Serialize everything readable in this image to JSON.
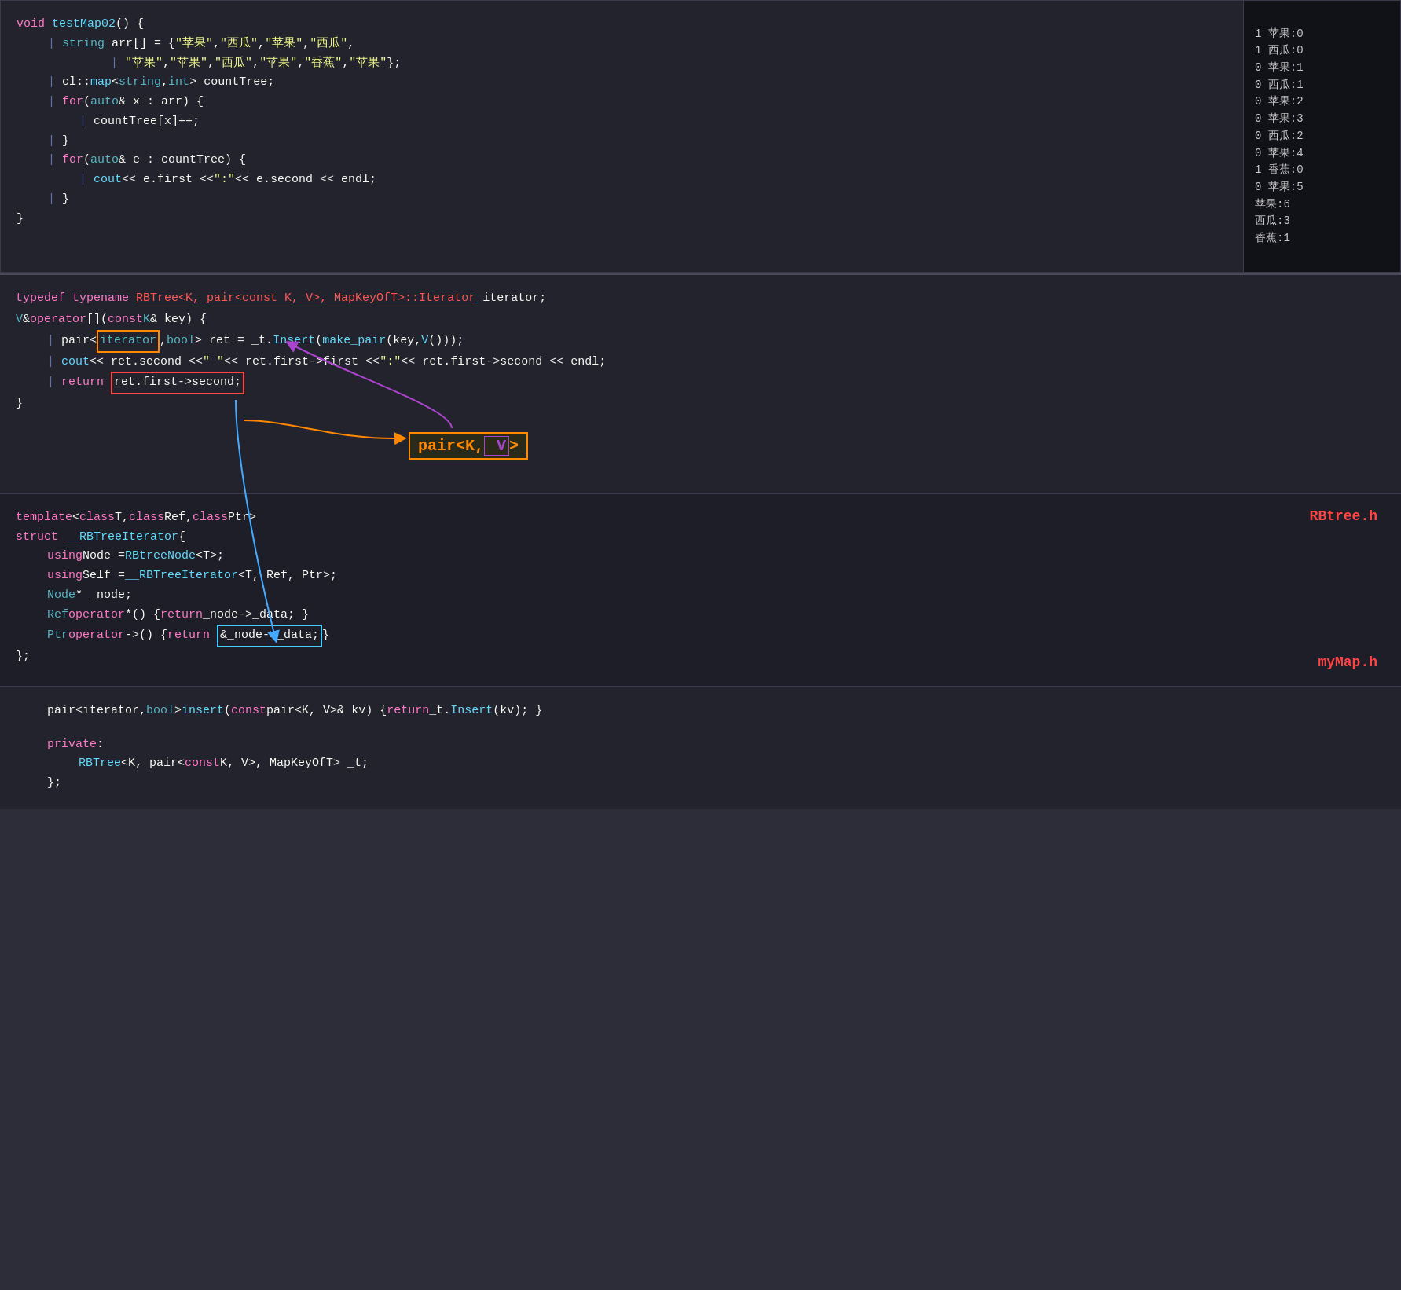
{
  "panels": {
    "top": {
      "code_lines": [
        {
          "parts": [
            {
              "t": "void",
              "c": "kw"
            },
            {
              "t": " testMap02() {",
              "c": "wht"
            }
          ]
        },
        {
          "indent": 1,
          "parts": [
            {
              "t": "string",
              "c": "cyan"
            },
            {
              "t": " arr[] = { ",
              "c": "wht"
            },
            {
              "t": "\"苹果\"",
              "c": "yel"
            },
            {
              "t": ", ",
              "c": "wht"
            },
            {
              "t": "\"西瓜\"",
              "c": "yel"
            },
            {
              "t": ", ",
              "c": "wht"
            },
            {
              "t": "\"苹果\"",
              "c": "yel"
            },
            {
              "t": ", ",
              "c": "wht"
            },
            {
              "t": "\"西瓜\"",
              "c": "yel"
            },
            {
              "t": ",",
              "c": "wht"
            }
          ]
        },
        {
          "indent": 2,
          "parts": [
            {
              "t": "\"苹果\"",
              "c": "yel"
            },
            {
              "t": ", ",
              "c": "wht"
            },
            {
              "t": "\"苹果\"",
              "c": "yel"
            },
            {
              "t": ", ",
              "c": "wht"
            },
            {
              "t": "\"西瓜\"",
              "c": "yel"
            },
            {
              "t": ", ",
              "c": "wht"
            },
            {
              "t": "\"苹果\"",
              "c": "yel"
            },
            {
              "t": ", ",
              "c": "wht"
            },
            {
              "t": "\"香蕉\"",
              "c": "yel"
            },
            {
              "t": ", ",
              "c": "wht"
            },
            {
              "t": "\"苹果\"",
              "c": "yel"
            },
            {
              "t": " };",
              "c": "wht"
            }
          ]
        },
        {
          "indent": 1,
          "parts": [
            {
              "t": "cl::",
              "c": "wht"
            },
            {
              "t": " map",
              "c": "fn"
            },
            {
              "t": "<",
              "c": "wht"
            },
            {
              "t": "string",
              "c": "cyan"
            },
            {
              "t": ", ",
              "c": "wht"
            },
            {
              "t": "int",
              "c": "cyan"
            },
            {
              "t": "> countTree;",
              "c": "wht"
            }
          ]
        },
        {
          "indent": 1,
          "parts": [
            {
              "t": "for",
              "c": "kw"
            },
            {
              "t": " (",
              "c": "wht"
            },
            {
              "t": "auto",
              "c": "cyan"
            },
            {
              "t": "& x : arr) {",
              "c": "wht"
            }
          ]
        },
        {
          "indent": 2,
          "parts": [
            {
              "t": "countTree[x]++;",
              "c": "wht"
            }
          ]
        },
        {
          "indent": 1,
          "parts": [
            {
              "t": "}",
              "c": "wht"
            }
          ]
        },
        {
          "indent": 1,
          "parts": [
            {
              "t": "for",
              "c": "kw"
            },
            {
              "t": " (",
              "c": "wht"
            },
            {
              "t": "auto",
              "c": "cyan"
            },
            {
              "t": "& e : countTree) {",
              "c": "wht"
            }
          ]
        },
        {
          "indent": 2,
          "parts": [
            {
              "t": "cout",
              "c": "fn"
            },
            {
              "t": " << e.first << ",
              "c": "wht"
            },
            {
              "t": "\":\"",
              "c": "yel"
            },
            {
              "t": " << e.second << endl;",
              "c": "wht"
            }
          ]
        },
        {
          "indent": 1,
          "parts": [
            {
              "t": "}",
              "c": "wht"
            }
          ]
        },
        {
          "parts": [
            {
              "t": "}",
              "c": "wht"
            }
          ]
        }
      ],
      "output": [
        "1 苹果:0",
        "1 西瓜:0",
        "0 苹果:1",
        "0 西瓜:1",
        "0 苹果:2",
        "0 苹果:3",
        "0 西瓜:2",
        "0 苹果:4",
        "1 香蕉:0",
        "0 苹果:5",
        "苹果:6",
        "西瓜:3",
        "香蕉:1"
      ]
    },
    "mid": {
      "label_rbtree": "RBtree.h",
      "label_mymap": "myMap.h"
    }
  }
}
